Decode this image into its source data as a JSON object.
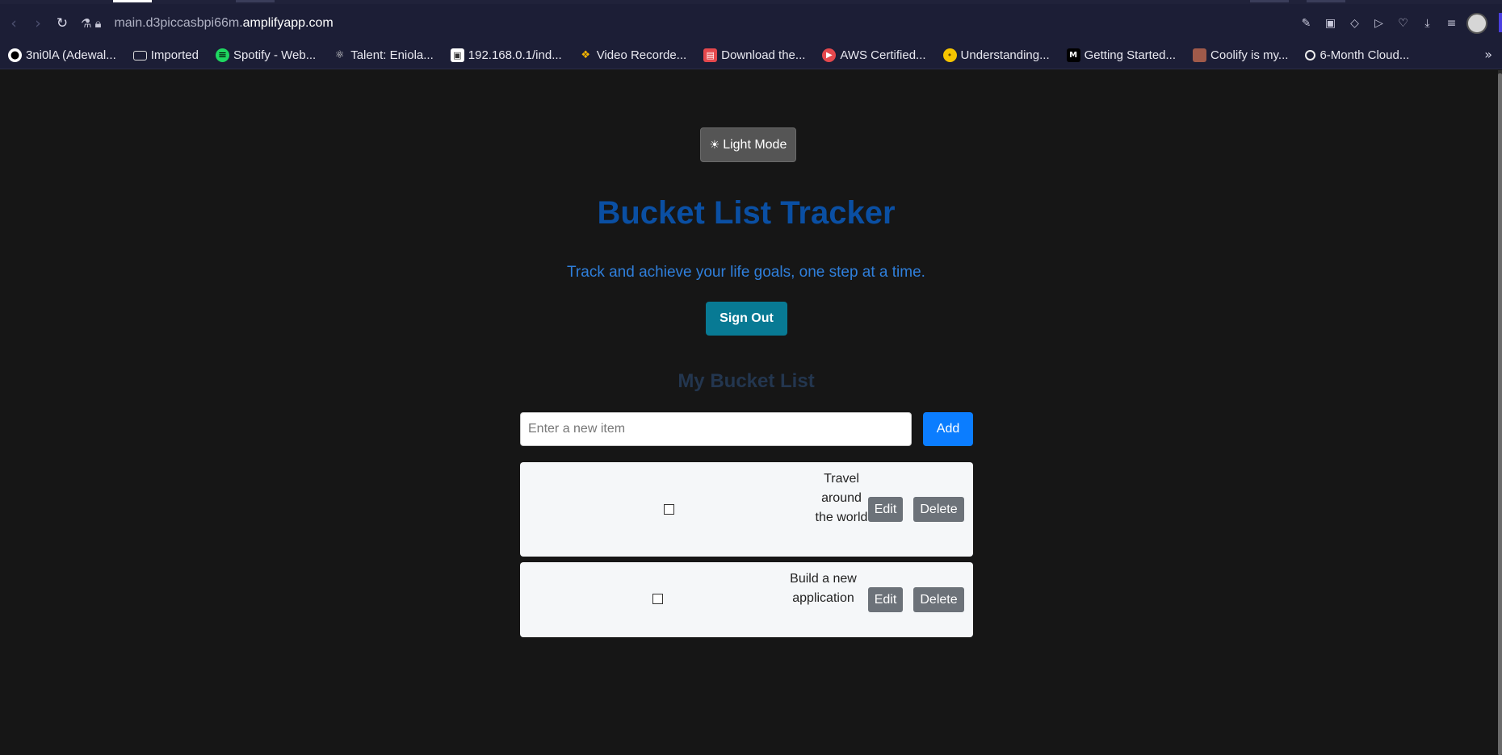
{
  "browser": {
    "url_host": "main.d3piccasbpi66m.",
    "url_domain": "amplifyapp.com",
    "bookmarks": [
      {
        "label": "3ni0lA  (Adewal..."
      },
      {
        "label": "Imported"
      },
      {
        "label": "Spotify  -  Web..."
      },
      {
        "label": "Talent:  Eniola..."
      },
      {
        "label": "192.168.0.1/ind..."
      },
      {
        "label": "Video  Recorde..."
      },
      {
        "label": "Download  the..."
      },
      {
        "label": "AWS  Certified..."
      },
      {
        "label": "Understanding..."
      },
      {
        "label": "Getting  Started..."
      },
      {
        "label": "Coolify  is  my..."
      },
      {
        "label": "6-Month  Cloud..."
      }
    ]
  },
  "app": {
    "theme_toggle_label": "Light Mode",
    "title": "Bucket List Tracker",
    "subtitle": "Track and achieve your life goals, one step at a time.",
    "signout_label": "Sign Out",
    "list_title": "My Bucket List",
    "new_item_placeholder": "Enter a new item",
    "add_label": "Add",
    "items": [
      {
        "text": "Travel around the world",
        "checked": false,
        "edit_label": "Edit",
        "delete_label": "Delete"
      },
      {
        "text": "Build a new application",
        "checked": false,
        "edit_label": "Edit",
        "delete_label": "Delete"
      }
    ]
  },
  "colors": {
    "page_bg": "#161616",
    "title": "#0a4fa3",
    "subtitle": "#2f7fdb",
    "signout": "#087a94",
    "add": "#0b7dff",
    "item_bg": "#f5f7f9",
    "item_button": "#6c7279"
  }
}
